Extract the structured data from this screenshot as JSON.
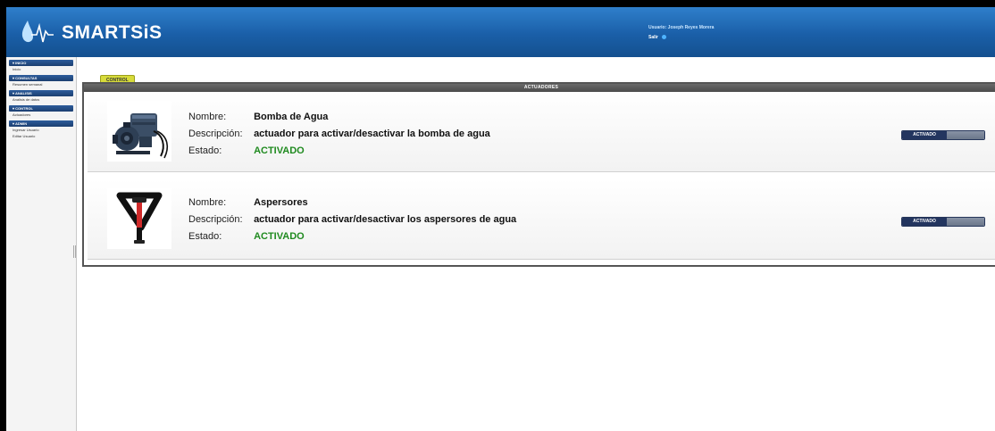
{
  "header": {
    "app_title": "SMARTSiS",
    "user_label": "Usuario:",
    "user_name": "Joseph Reyes Morera",
    "logout_label": "Salir"
  },
  "sidebar": {
    "sections": [
      {
        "title": "▾ INICIO",
        "items": [
          "Inicio"
        ]
      },
      {
        "title": "▾ CONSULTAS",
        "items": [
          "Resumen semanal"
        ]
      },
      {
        "title": "▾ ANALISIS",
        "items": [
          "Analisis de datos"
        ]
      },
      {
        "title": "▾ CONTROL",
        "items": [
          "Actuadores"
        ]
      },
      {
        "title": "▾ ADMIN",
        "items": [
          "Ingresar Usuario",
          "Editar Usuario"
        ]
      }
    ]
  },
  "main": {
    "tab_label": "CONTROL",
    "panel_title": "ACTUADORES",
    "labels": {
      "name": "Nombre:",
      "description": "Descripción:",
      "status": "Estado:"
    },
    "actuators": [
      {
        "name": "Bomba de Agua",
        "description": "actuador para activar/desactivar la bomba de agua",
        "status": "ACTIVADO",
        "toggle_label": "ACTIVADO",
        "image_icon": "water-pump-icon"
      },
      {
        "name": "Aspersores",
        "description": "actuador para activar/desactivar los aspersores de agua",
        "status": "ACTIVADO",
        "toggle_label": "ACTIVADO",
        "image_icon": "sprinkler-icon"
      }
    ]
  },
  "colors": {
    "header_blue": "#1a5fa8",
    "status_green": "#1f8a1f",
    "toggle_navy": "#23355f",
    "tab_yellow": "#d7db3a"
  }
}
